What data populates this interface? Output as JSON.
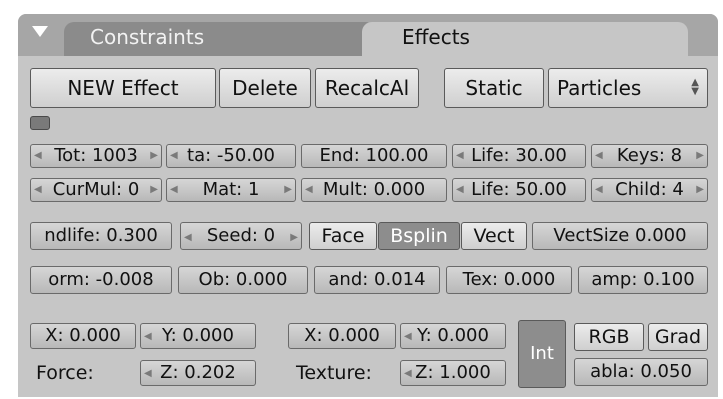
{
  "tabs": {
    "constraints": "Constraints",
    "effects": "Effects"
  },
  "toolbar": {
    "new_effect": "NEW Effect",
    "delete": "Delete",
    "recalc": "RecalcAl",
    "static": "Static",
    "type_select": "Particles"
  },
  "row1": {
    "tot": "Tot: 1003",
    "sta": "ta: -50.00",
    "end": "End: 100.00",
    "life": "Life: 30.00",
    "keys": "Keys: 8"
  },
  "row2": {
    "curmul": "CurMul: 0",
    "mat": "Mat: 1",
    "mult": "Mult: 0.000",
    "life": "Life: 50.00",
    "child": "Child: 4"
  },
  "row3": {
    "randlife": "ndlife: 0.300",
    "seed": "Seed: 0",
    "face": "Face",
    "bspline": "Bsplin",
    "vect": "Vect",
    "vectsize": "VectSize 0.000"
  },
  "row4": {
    "norm": "orm: -0.008",
    "ob": "Ob: 0.000",
    "rand": "and: 0.014",
    "tex": "Tex: 0.000",
    "damp": "amp: 0.100"
  },
  "force": {
    "label": "Force:",
    "x": "X: 0.000",
    "y": "Y: 0.000",
    "z": "Z: 0.202"
  },
  "texture": {
    "label": "Texture:",
    "x": "X: 0.000",
    "y": "Y: 0.000",
    "z": "Z: 1.000"
  },
  "texmode": {
    "int": "Int",
    "rgb": "RGB",
    "grad": "Grad",
    "nabla": "abla: 0.050"
  }
}
